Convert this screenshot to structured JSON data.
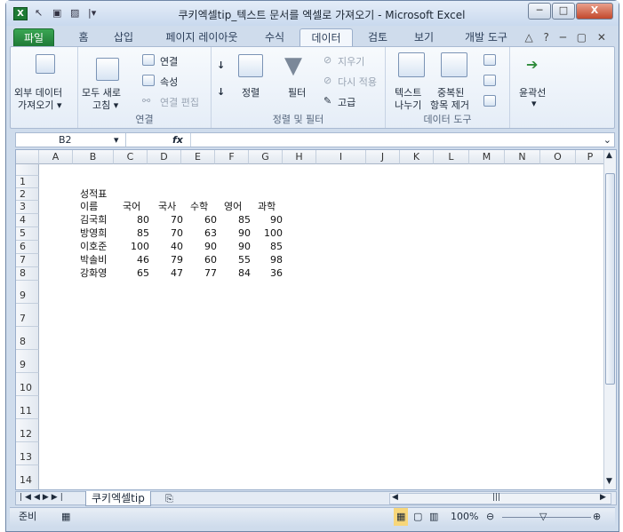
{
  "window": {
    "title": "쿠키엑셀tip_텍스트 문서를 엑셀로 가져오기 - Microsoft Excel",
    "app_icon": "X",
    "minimize": "─",
    "maximize": "□",
    "close": "X"
  },
  "tabs": [
    {
      "label": "파일"
    },
    {
      "label": "홈"
    },
    {
      "label": "삽입"
    },
    {
      "label": "페이지 레이아웃"
    },
    {
      "label": "수식"
    },
    {
      "label": "데이터"
    },
    {
      "label": "검토"
    },
    {
      "label": "보기"
    },
    {
      "label": "개발 도구"
    }
  ],
  "ribbon": {
    "external_data": {
      "line1": "외부 데이터",
      "line2": "가져오기 ▾"
    },
    "connections": {
      "refresh_line1": "모두 새로",
      "refresh_line2": "고침 ▾",
      "connect": "연결",
      "properties": "속성",
      "edit_links": "연결 편집",
      "group": "연결"
    },
    "sort_filter": {
      "sort": "정렬",
      "filter": "필터",
      "clear": "지우기",
      "reapply": "다시 적용",
      "advanced": "고급",
      "group": "정렬 및 필터"
    },
    "data_tools": {
      "text_split_1": "텍스트",
      "text_split_2": "나누기",
      "dup_1": "중복된",
      "dup_2": "항목 제거",
      "group": "데이터 도구"
    },
    "outline": {
      "label": "윤곽선",
      "arrow": "▾"
    }
  },
  "formula_bar": {
    "name_box": "B2",
    "fx": "fx",
    "formula": ""
  },
  "columns": [
    "A",
    "B",
    "C",
    "D",
    "E",
    "F",
    "G",
    "H",
    "I",
    "J",
    "K",
    "L",
    "M",
    "N",
    "O",
    "P"
  ],
  "rows": [
    "1",
    "2",
    "3",
    "4",
    "5",
    "6",
    "7",
    "8",
    "9",
    "7",
    "8",
    "9",
    "10",
    "11",
    "12",
    "13",
    "14"
  ],
  "cells": {
    "title": "성적표",
    "header": [
      "이름",
      "국어",
      "국사",
      "수학",
      "영어",
      "과학"
    ],
    "data": [
      [
        "김국희",
        "80",
        "70",
        "60",
        "85",
        "90"
      ],
      [
        "방영희",
        "85",
        "70",
        "63",
        "90",
        "100"
      ],
      [
        "이호준",
        "100",
        "40",
        "90",
        "90",
        "85"
      ],
      [
        "박솔비",
        "46",
        "79",
        "60",
        "55",
        "98"
      ],
      [
        "강화영",
        "65",
        "47",
        "77",
        "84",
        "36"
      ]
    ]
  },
  "sheet_tab": "쿠키엑셀tip",
  "status": {
    "ready": "준비",
    "zoom": "100%"
  }
}
